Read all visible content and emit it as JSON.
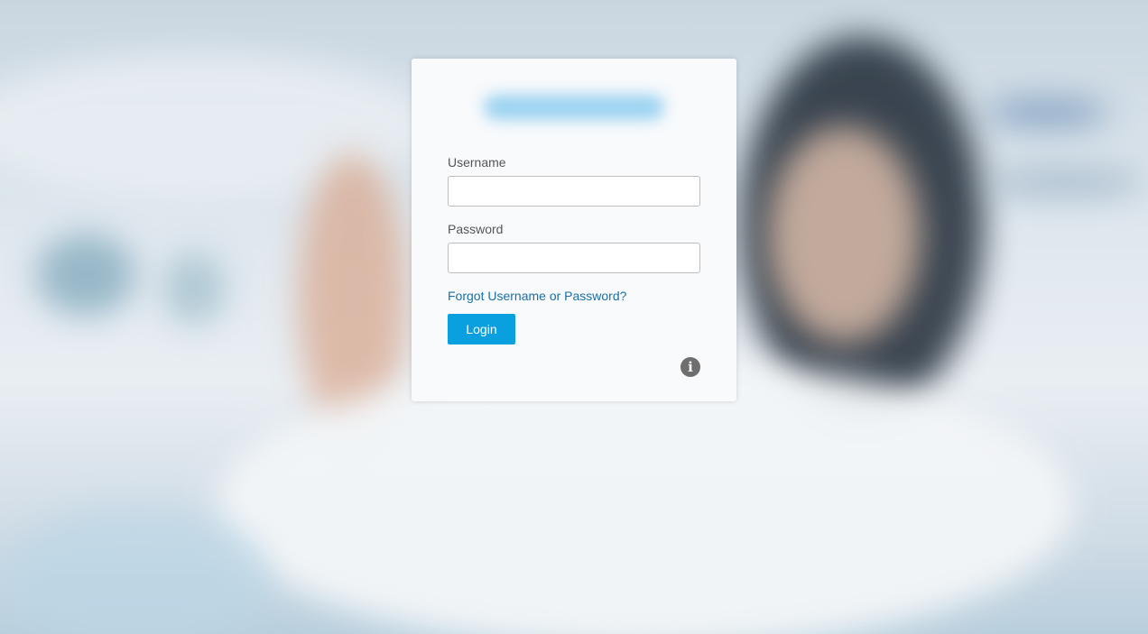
{
  "form": {
    "username_label": "Username",
    "username_value": "",
    "password_label": "Password",
    "password_value": "",
    "forgot_link": "Forgot Username or Password?",
    "login_button": "Login",
    "info_icon": "info-icon"
  },
  "colors": {
    "accent": "#0aa0e0",
    "link": "#1a6fa8",
    "card_bg": "#f8fafc"
  }
}
